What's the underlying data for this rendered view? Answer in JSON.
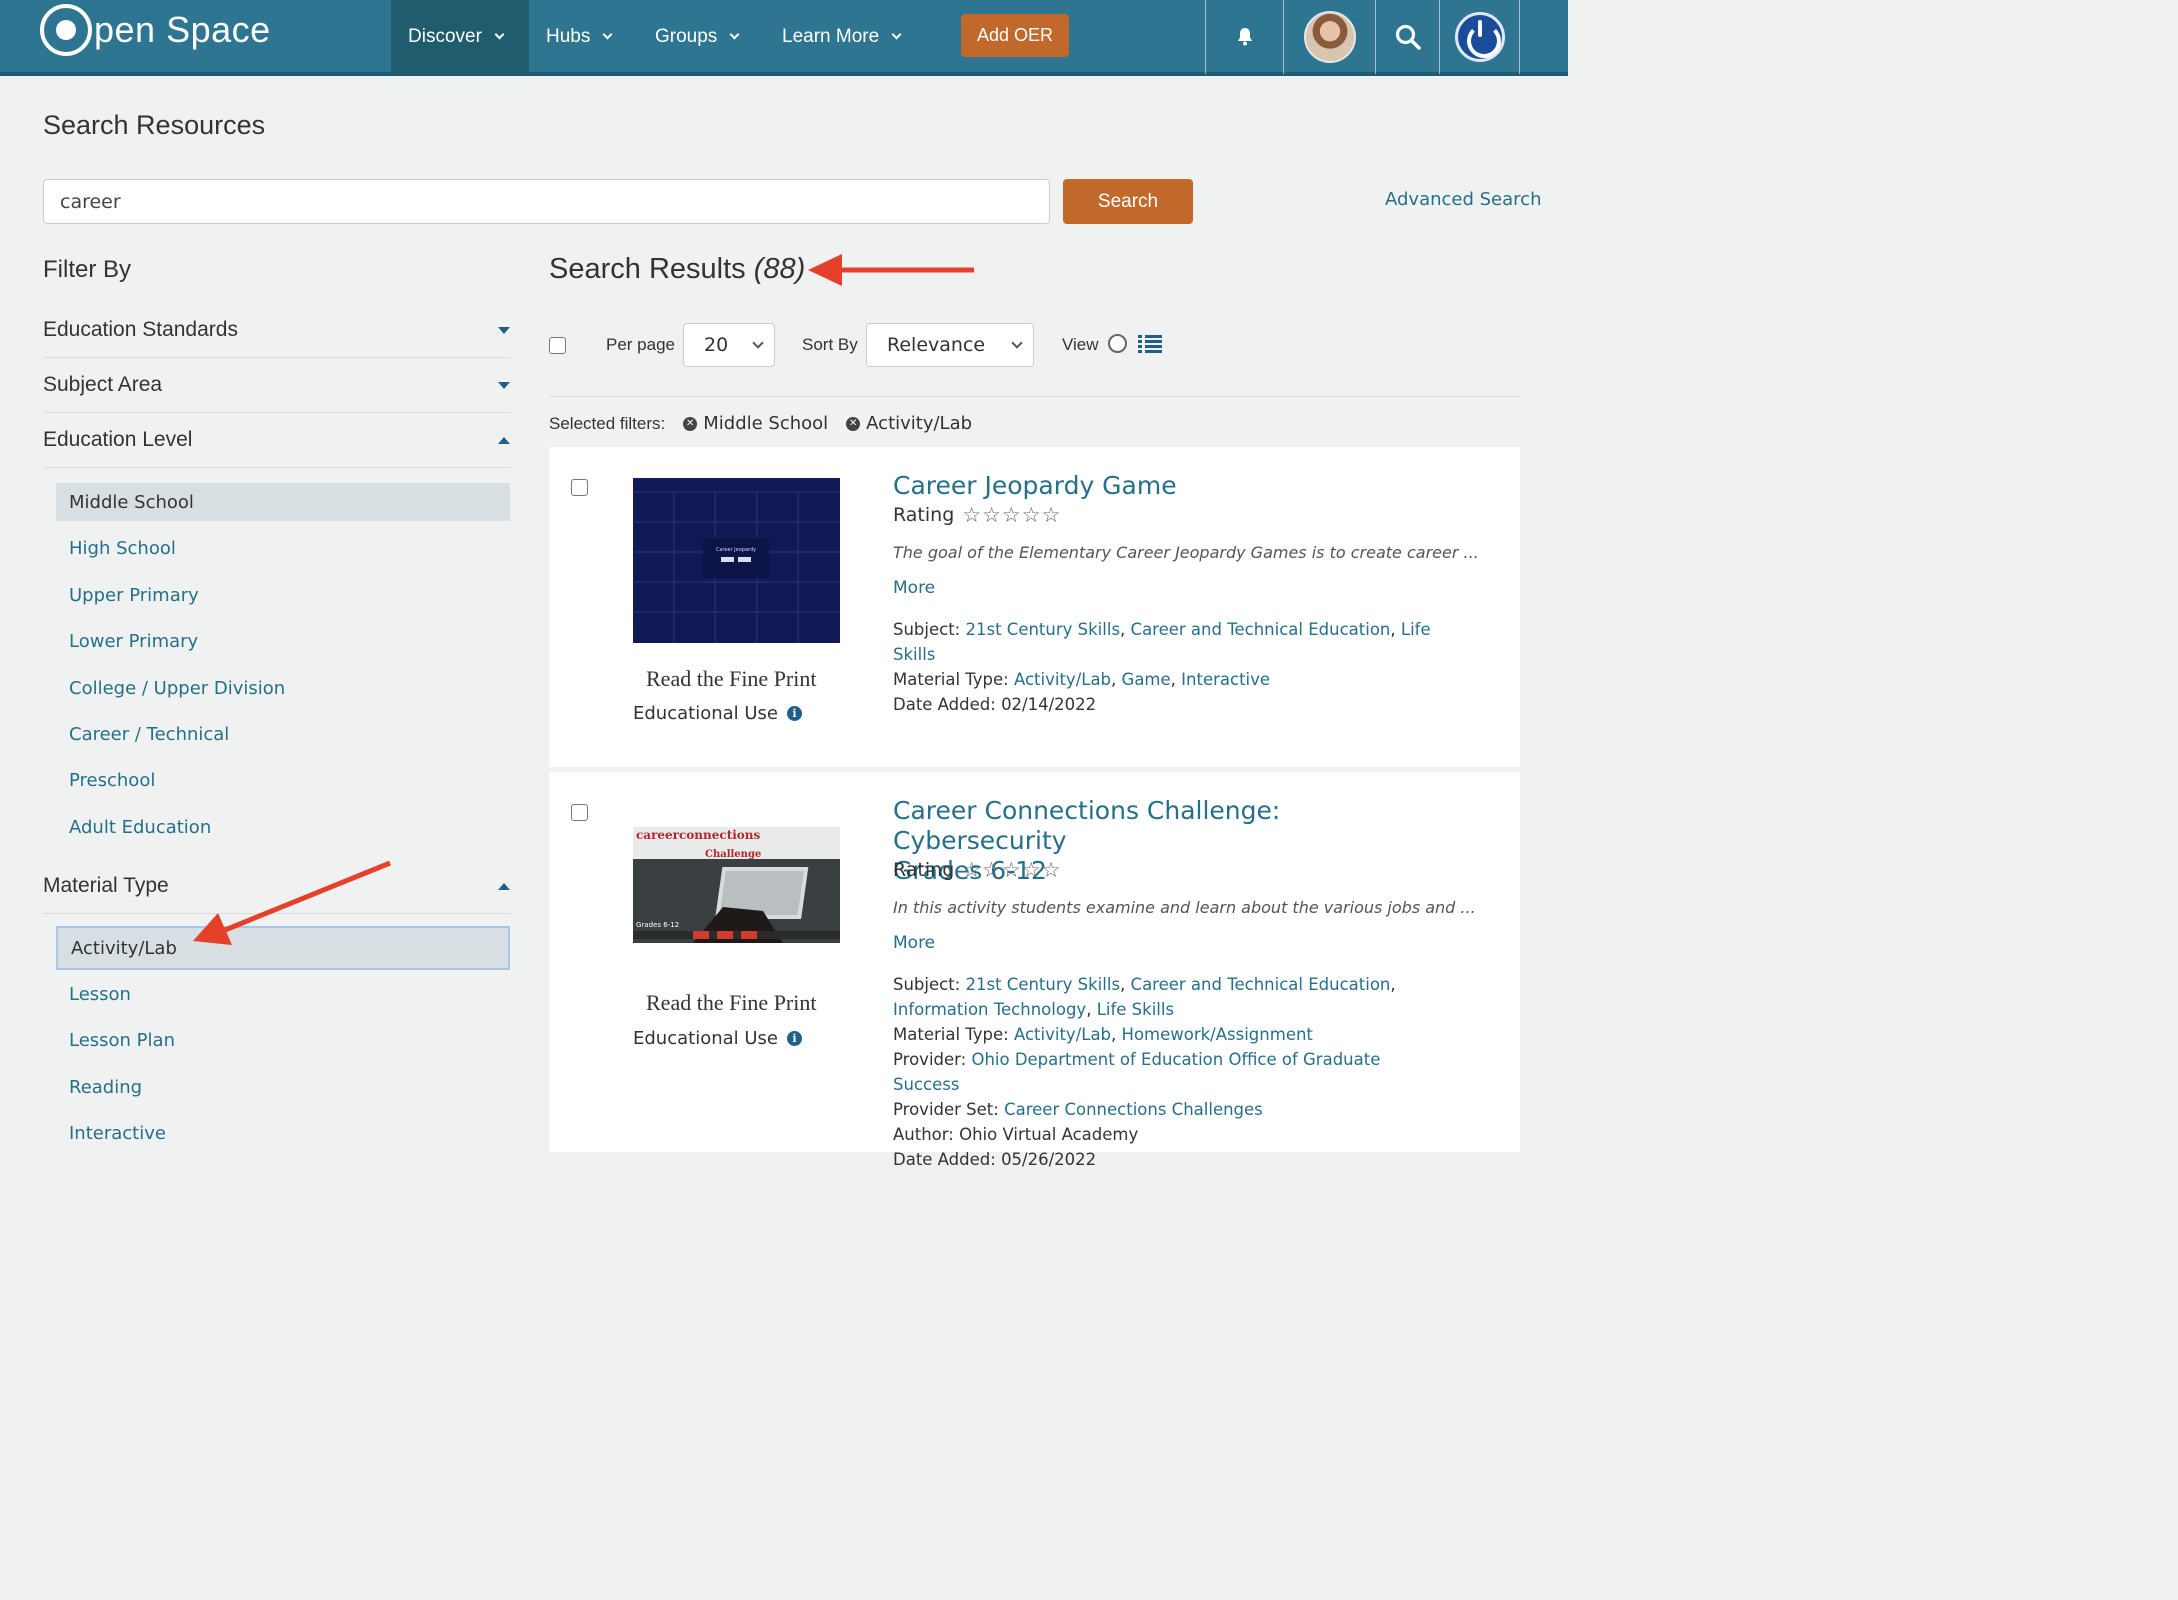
{
  "nav": {
    "brand": "pen Space",
    "items": [
      "Discover",
      "Hubs",
      "Groups",
      "Learn More"
    ],
    "add_oer": "Add OER"
  },
  "page": {
    "title": "Search Resources",
    "search_value": "career",
    "search_button": "Search",
    "advanced_search": "Advanced Search"
  },
  "sidebar": {
    "filter_by": "Filter By",
    "sections": [
      "Education Standards",
      "Subject Area",
      "Education Level",
      "Material Type"
    ],
    "education_levels": [
      "Middle School",
      "High School",
      "Upper Primary",
      "Lower Primary",
      "College / Upper Division",
      "Career / Technical",
      "Preschool",
      "Adult Education"
    ],
    "material_types": [
      "Activity/Lab",
      "Lesson",
      "Lesson Plan",
      "Reading",
      "Interactive"
    ]
  },
  "results": {
    "title": "Search Results",
    "count": "(88)",
    "per_page_label": "Per page",
    "per_page_value": "20",
    "sort_by_label": "Sort By",
    "sort_by_value": "Relevance",
    "view_label": "View",
    "selected_filters_label": "Selected filters:",
    "selected_filters": [
      "Middle School",
      "Activity/Lab"
    ],
    "fine_print": "Read the Fine Print",
    "edu_use": "Educational Use",
    "rating_label": "Rating",
    "stars": "☆☆☆☆☆",
    "more": "More",
    "thumb1_caption": "Career Jeopardy",
    "thumb2_brand": "careerconnections",
    "thumb2_challenge": "Challenge",
    "thumb2_grades": "Grades 6-12",
    "items": [
      {
        "title": "Career Jeopardy Game",
        "desc": "The goal of the Elementary Career Jeopardy Games is to create career ...",
        "subject_label": "Subject:",
        "subjects": [
          "21st Century Skills",
          "Career and Technical Education",
          "Life Skills"
        ],
        "material_label": "Material Type:",
        "materials": [
          "Activity/Lab",
          "Game",
          "Interactive"
        ],
        "date_label": "Date Added:",
        "date": "02/14/2022"
      },
      {
        "title_line1": "Career Connections Challenge: Cybersecurity",
        "title_line2": "Grades 6-12",
        "desc": "In this activity students examine and learn about the various jobs and ...",
        "subject_label": "Subject:",
        "subjects": [
          "21st Century Skills",
          "Career and Technical Education",
          "Information Technology",
          "Life Skills"
        ],
        "material_label": "Material Type:",
        "materials": [
          "Activity/Lab",
          "Homework/Assignment"
        ],
        "provider_label": "Provider:",
        "provider": "Ohio Department of Education Office of Graduate Success",
        "provider_set_label": "Provider Set:",
        "provider_set": "Career Connections Challenges",
        "author_label": "Author:",
        "author": "Ohio Virtual Academy",
        "date_label": "Date Added:",
        "date": "05/26/2022"
      }
    ]
  },
  "colors": {
    "nav_bg": "#2d7590",
    "accent": "#c0692a",
    "link": "#256f8a",
    "arrow": "#e5402a"
  }
}
